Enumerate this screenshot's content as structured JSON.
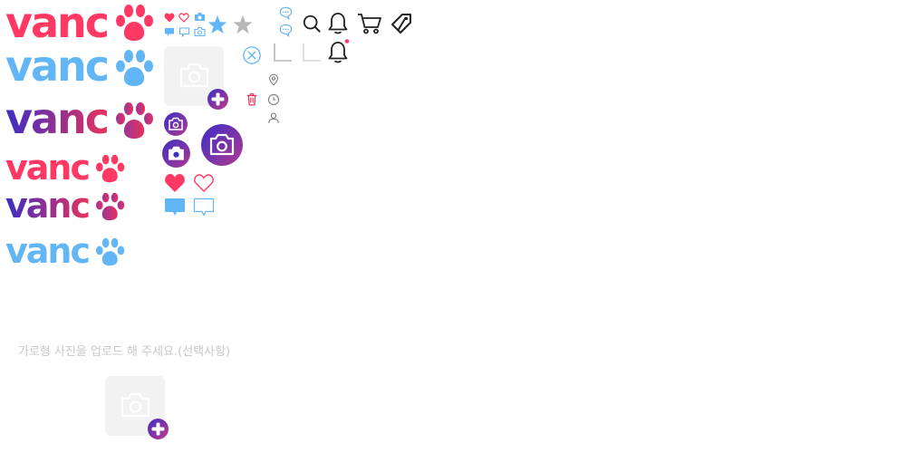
{
  "brand": {
    "wordmark": "vanc",
    "colors": {
      "pink": "#ff3864",
      "blue": "#62b6f5",
      "indigo": "#3a2ec4",
      "gray_icon": "#b7b7b7",
      "outline": "#222222",
      "placeholder_bg": "#f2f2f2"
    }
  },
  "logos": [
    {
      "variant": "pink",
      "size": "large"
    },
    {
      "variant": "blue",
      "size": "large"
    },
    {
      "variant": "gradient",
      "size": "large"
    },
    {
      "variant": "pink",
      "size": "small"
    },
    {
      "variant": "gradient",
      "size": "small"
    },
    {
      "variant": "blue",
      "size": "small"
    }
  ],
  "icons": [
    "heart-filled-icon",
    "heart-outline-icon",
    "camera-small-icon",
    "chat-filled-icon",
    "chat-outline-icon",
    "camera-outline-icon",
    "star-blue-icon",
    "star-gray-icon",
    "chat-dots-icon",
    "search-icon",
    "bell-icon",
    "cart-icon",
    "tag-icon",
    "close-circle-icon",
    "corner-icon",
    "bell-new-icon",
    "location-icon",
    "clock-icon",
    "user-icon",
    "trash-icon"
  ],
  "upload": {
    "hint": "가로형 사진을 업로드 해 주세요.(선택사항)"
  }
}
